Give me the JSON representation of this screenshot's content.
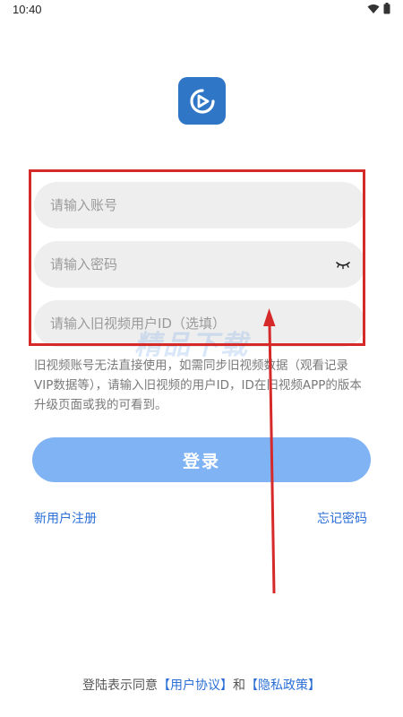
{
  "status_bar": {
    "time": "10:40",
    "icons": [
      "wifi-icon",
      "battery-icon"
    ]
  },
  "app_icon": "play-icon",
  "form": {
    "account_placeholder": "请输入账号",
    "password_placeholder": "请输入密码",
    "old_id_placeholder": "请输入旧视频用户ID（选填）",
    "password_toggle_icon": "eye-closed-icon"
  },
  "hint": "旧视频账号无法直接使用，如需同步旧视频数据（观看记录 VIP数据等），请输入旧视频的用户ID，ID在旧视频APP的版本升级页面或我的可看到。",
  "login_button": "登录",
  "links": {
    "register": "新用户注册",
    "forgot": "忘记密码"
  },
  "footer": {
    "prefix": "登陆表示同意",
    "user_agreement": "【用户协议】",
    "and": "和",
    "privacy_policy": "【隐私政策】"
  },
  "watermark": "精品下载",
  "colors": {
    "accent": "#2f76c6",
    "button": "#7fb3f3",
    "link": "#2b6fd6",
    "annotation": "#d62a2a",
    "input_bg": "#eeeeee"
  }
}
